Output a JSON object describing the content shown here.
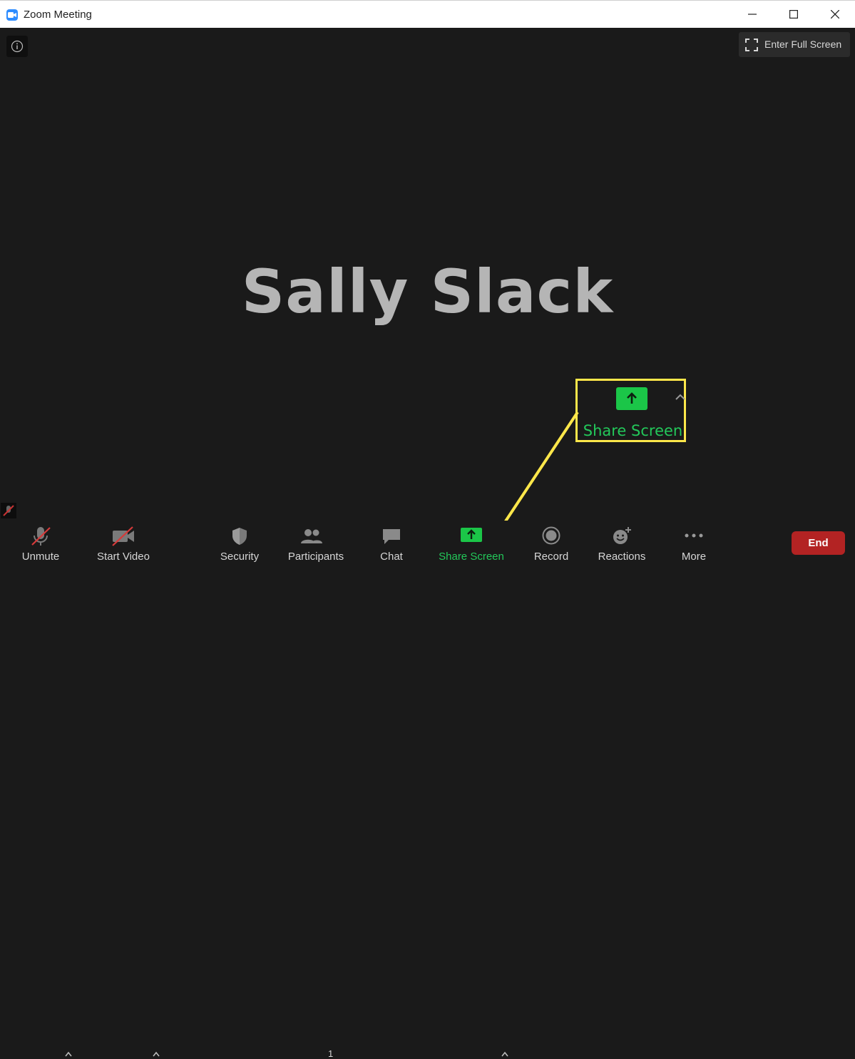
{
  "window": {
    "title": "Zoom Meeting",
    "accent": "#2d8cff"
  },
  "stage": {
    "participant_name": "Sally Slack",
    "fullscreen_label": "Enter Full Screen"
  },
  "callout": {
    "label": "Share Screen",
    "highlight_color": "#ffe74a",
    "label_color": "#23c85a"
  },
  "toolbar": {
    "unmute": "Unmute",
    "start_video": "Start Video",
    "security": "Security",
    "participants": "Participants",
    "participants_count": "1",
    "chat": "Chat",
    "share_screen": "Share Screen",
    "record": "Record",
    "reactions": "Reactions",
    "more": "More",
    "end": "End",
    "end_color": "#b32323"
  }
}
